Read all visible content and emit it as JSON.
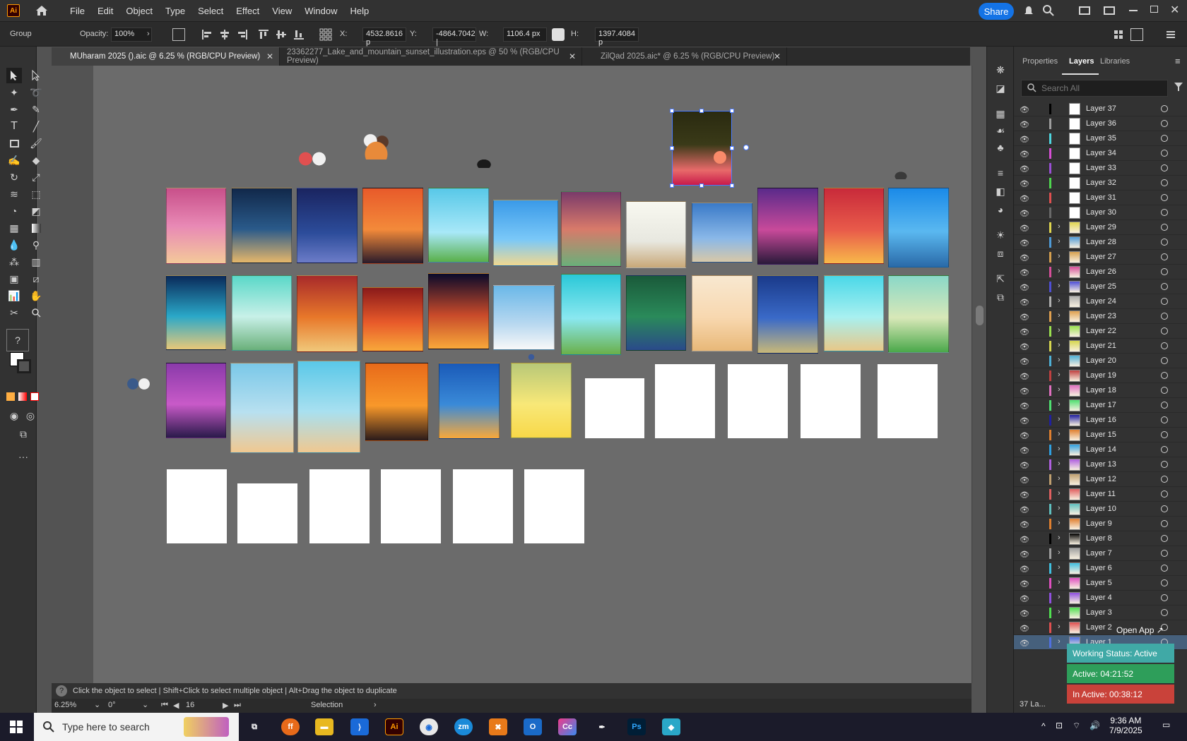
{
  "menubar": {
    "app_icon": "Ai",
    "items": [
      "File",
      "Edit",
      "Object",
      "Type",
      "Select",
      "Effect",
      "View",
      "Window",
      "Help"
    ],
    "share_label": "Share"
  },
  "controlbar": {
    "object_type": "Group",
    "opacity_label": "Opacity:",
    "opacity_value": "100%",
    "x_label": "X:",
    "x_value": "4532.8616 p",
    "y_label": "Y:",
    "y_value": "-4864.7042 |",
    "w_label": "W:",
    "w_value": "1106.4 px",
    "h_label": "H:",
    "h_value": "1397.4084 p"
  },
  "tabs": [
    {
      "label": "MUharam 2025 ().aic @ 6.25 % (RGB/CPU Preview)",
      "active": true
    },
    {
      "label": "23362277_Lake_and_mountain_sunset_illustration.eps @ 50 % (RGB/CPU Preview)",
      "active": false
    },
    {
      "label": "ZilQad 2025.aic* @ 6.25 % (RGB/CPU Preview)",
      "active": false
    }
  ],
  "hint": {
    "text": "Click the object to select  |  Shift+Click to select multiple object  |  Alt+Drag the object to duplicate"
  },
  "statusbar": {
    "zoom": "6.25%",
    "rotation": "0°",
    "artboard_number": "16",
    "tool": "Selection"
  },
  "panel": {
    "tabs": [
      "Properties",
      "Layers",
      "Libraries"
    ],
    "active_tab": "Layers",
    "search_placeholder": "Search All",
    "layers": [
      {
        "name": "Layer 37",
        "color": "#000000",
        "has_arrow": false
      },
      {
        "name": "Layer 36",
        "color": "#9e9e9e",
        "has_arrow": false
      },
      {
        "name": "Layer 35",
        "color": "#4fd6e0",
        "has_arrow": false
      },
      {
        "name": "Layer 34",
        "color": "#d84fd6",
        "has_arrow": false
      },
      {
        "name": "Layer 33",
        "color": "#9a4fd6",
        "has_arrow": false
      },
      {
        "name": "Layer 32",
        "color": "#4fd64f",
        "has_arrow": false
      },
      {
        "name": "Layer 31",
        "color": "#e05050",
        "has_arrow": false
      },
      {
        "name": "Layer 30",
        "color": "#6a6a6a",
        "has_arrow": false
      },
      {
        "name": "Layer 29",
        "color": "#e0d64f",
        "has_arrow": true
      },
      {
        "name": "Layer 28",
        "color": "#4f9ad6",
        "has_arrow": true
      },
      {
        "name": "Layer 27",
        "color": "#d6a04f",
        "has_arrow": true
      },
      {
        "name": "Layer 26",
        "color": "#d64f9a",
        "has_arrow": true
      },
      {
        "name": "Layer 25",
        "color": "#4f4fd6",
        "has_arrow": true
      },
      {
        "name": "Layer 24",
        "color": "#b0b0b0",
        "has_arrow": true
      },
      {
        "name": "Layer 23",
        "color": "#e0a04f",
        "has_arrow": true
      },
      {
        "name": "Layer 22",
        "color": "#9ae04f",
        "has_arrow": true
      },
      {
        "name": "Layer 21",
        "color": "#d6d64f",
        "has_arrow": true
      },
      {
        "name": "Layer 20",
        "color": "#4fb0d6",
        "has_arrow": true
      },
      {
        "name": "Layer 19",
        "color": "#c04040",
        "has_arrow": true
      },
      {
        "name": "Layer 18",
        "color": "#e070c0",
        "has_arrow": true
      },
      {
        "name": "Layer 17",
        "color": "#4fe070",
        "has_arrow": true
      },
      {
        "name": "Layer 16",
        "color": "#2020a0",
        "has_arrow": true
      },
      {
        "name": "Layer 15",
        "color": "#e08030",
        "has_arrow": true
      },
      {
        "name": "Layer 14",
        "color": "#30a0e0",
        "has_arrow": true
      },
      {
        "name": "Layer 13",
        "color": "#b060e0",
        "has_arrow": true
      },
      {
        "name": "Layer 12",
        "color": "#c0a070",
        "has_arrow": true
      },
      {
        "name": "Layer 11",
        "color": "#e06060",
        "has_arrow": true
      },
      {
        "name": "Layer 10",
        "color": "#60c0c0",
        "has_arrow": true
      },
      {
        "name": "Layer 9",
        "color": "#e08030",
        "has_arrow": true
      },
      {
        "name": "Layer 8",
        "color": "#000000",
        "has_arrow": true
      },
      {
        "name": "Layer 7",
        "color": "#a0a0a0",
        "has_arrow": true
      },
      {
        "name": "Layer 6",
        "color": "#40c0e0",
        "has_arrow": true
      },
      {
        "name": "Layer 5",
        "color": "#e050c0",
        "has_arrow": true
      },
      {
        "name": "Layer 4",
        "color": "#9050e0",
        "has_arrow": true
      },
      {
        "name": "Layer 3",
        "color": "#50e050",
        "has_arrow": true
      },
      {
        "name": "Layer 2",
        "color": "#e05050",
        "has_arrow": true
      },
      {
        "name": "Layer 1",
        "color": "#5070e0",
        "has_arrow": true
      }
    ],
    "layer_count": "37 La..."
  },
  "widget": {
    "open_app": "Open App ↗",
    "status": "Working Status: Active",
    "active": "Active: 04:21:52",
    "inactive": "In Active: 00:38:12"
  },
  "taskbar": {
    "search_placeholder": "Type here to search",
    "time": "9:36 AM",
    "date": "7/9/2025"
  }
}
